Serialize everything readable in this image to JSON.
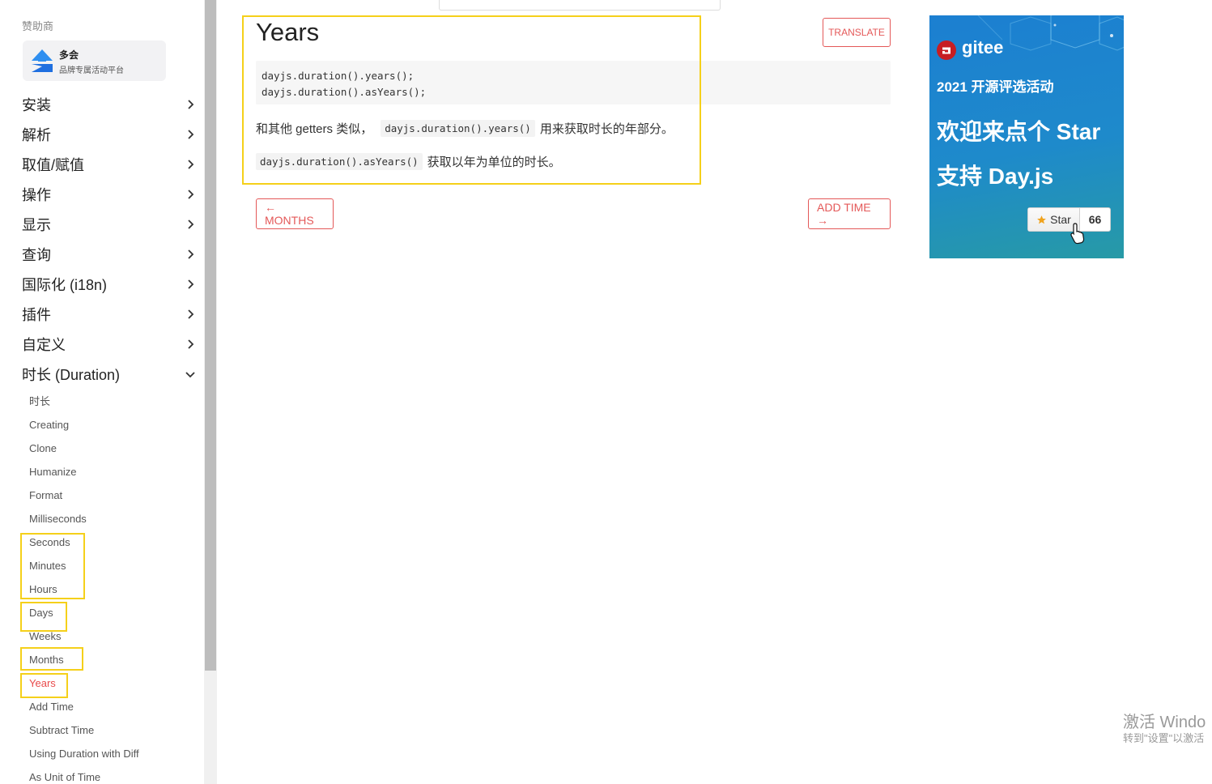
{
  "sidebar": {
    "sponsor_heading": "赞助商",
    "sponsor": {
      "name": "多会",
      "tagline": "品牌专属活动平台"
    },
    "nav": [
      {
        "label": "安装",
        "expanded": false
      },
      {
        "label": "解析",
        "expanded": false
      },
      {
        "label": "取值/赋值",
        "expanded": false
      },
      {
        "label": "操作",
        "expanded": false
      },
      {
        "label": "显示",
        "expanded": false
      },
      {
        "label": "查询",
        "expanded": false
      },
      {
        "label": "国际化 (i18n)",
        "expanded": false
      },
      {
        "label": "插件",
        "expanded": false
      },
      {
        "label": "自定义",
        "expanded": false
      },
      {
        "label": "时长 (Duration)",
        "expanded": true
      }
    ],
    "duration_items": [
      "时长",
      "Creating",
      "Clone",
      "Humanize",
      "Format",
      "Milliseconds",
      "Seconds",
      "Minutes",
      "Hours",
      "Days",
      "Weeks",
      "Months",
      "Years",
      "Add Time",
      "Subtract Time",
      "Using Duration with Diff",
      "As Unit of Time"
    ],
    "active_item": "Years"
  },
  "main": {
    "title": "Years",
    "translate_label": "TRANSLATE",
    "code_lines": [
      "dayjs.duration().years();",
      "dayjs.duration().asYears();"
    ],
    "para1": {
      "before": "和其他 getters 类似，",
      "code": "dayjs.duration().years()",
      "after": "用来获取时长的年部分。"
    },
    "para2": {
      "code": "dayjs.duration().asYears()",
      "after": "获取以年为单位的时长。"
    },
    "prev_label": "← MONTHS",
    "next_label": "ADD TIME →"
  },
  "ad": {
    "brand": "gitee",
    "subtitle": "2021 开源评选活动",
    "line1": "欢迎来点个 Star",
    "line2": "支持 Day.js",
    "star_label": "Star",
    "star_count": "66"
  },
  "watermark": {
    "line1": "激活 Windo",
    "line2": "转到\"设置\"以激活"
  },
  "colors": {
    "accent": "#e45858",
    "highlight": "#f5d01a",
    "ad_blue": "#1e8acb"
  }
}
